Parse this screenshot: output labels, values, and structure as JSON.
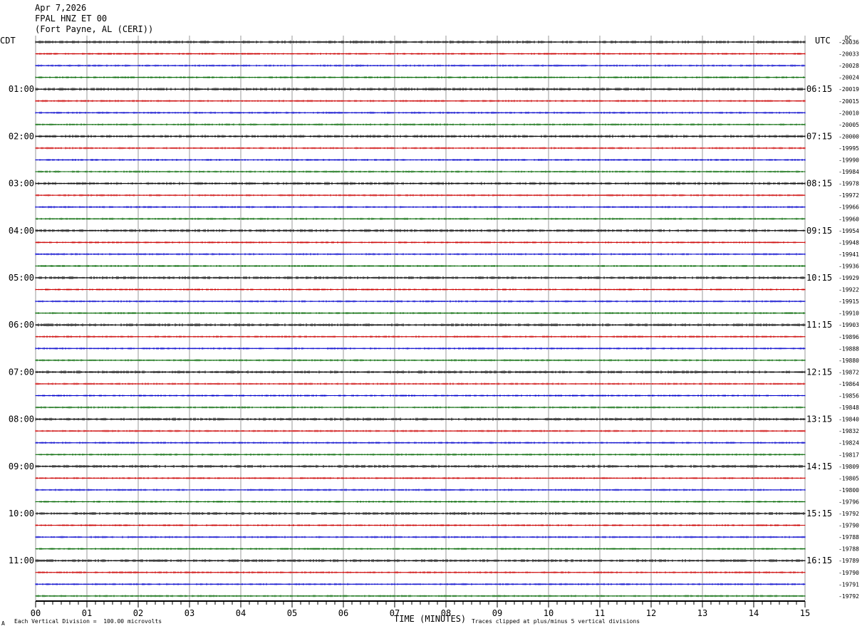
{
  "header": {
    "date": "Apr 7,2026",
    "station": "FPAL HNZ ET 00",
    "location": "(Fort Payne, AL (CERI))"
  },
  "labels": {
    "left_tz": "CDT",
    "right_tz": "UTC",
    "dc": "DC",
    "xlabel": "TIME (MINUTES)",
    "scale_note": "Each Vertical Division =  100.00 microvolts",
    "clip_note": "Traces clipped at plus/minus 5 vertical divisions",
    "corner_mark": "A"
  },
  "colors": {
    "trace_cycle": [
      "#000000",
      "#cc0000",
      "#0000cc",
      "#006600"
    ],
    "grid": "#999999"
  },
  "chart_data": {
    "type": "line",
    "title": "FPAL HNZ ET 00",
    "xlabel": "TIME (MINUTES)",
    "xlim": [
      0,
      15
    ],
    "x_ticks": [
      "00",
      "01",
      "02",
      "03",
      "04",
      "05",
      "06",
      "07",
      "08",
      "09",
      "10",
      "11",
      "12",
      "13",
      "14",
      "15"
    ],
    "local_hour_labels": [
      "01:00",
      "02:00",
      "03:00",
      "04:00",
      "05:00",
      "06:00",
      "07:00",
      "08:00",
      "09:00",
      "10:00",
      "11:00"
    ],
    "utc_hour_labels": [
      "06:15",
      "07:15",
      "08:15",
      "09:15",
      "10:15",
      "11:15",
      "12:15",
      "13:15",
      "14:15",
      "15:15",
      "16:15"
    ],
    "trace_dc_offsets": [
      -20036,
      -20033,
      -20028,
      -20024,
      -20019,
      -20015,
      -20010,
      -20005,
      -20000,
      -19995,
      -19990,
      -19984,
      -19978,
      -19972,
      -19966,
      -19960,
      -19954,
      -19948,
      -19941,
      -19936,
      -19929,
      -19922,
      -19915,
      -19910,
      -19903,
      -19896,
      -19888,
      -19880,
      -19872,
      -19864,
      -19856,
      -19848,
      -19840,
      -19832,
      -19824,
      -19817,
      -19809,
      -19805,
      -19800,
      -19796,
      -19792,
      -19790,
      -19788,
      -19788,
      -19789,
      -19790,
      -19791,
      -19792
    ],
    "grid": true
  }
}
